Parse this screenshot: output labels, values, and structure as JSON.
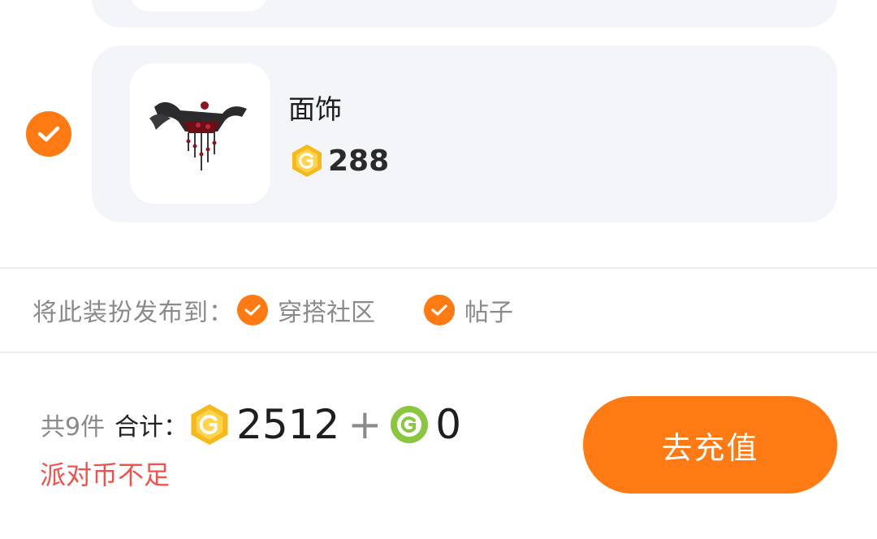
{
  "item": {
    "name": "面饰",
    "price": "288",
    "selected": true,
    "icon": "mask-accessory-image"
  },
  "publish": {
    "label": "将此装扮发布到：",
    "options": [
      {
        "label": "穿搭社区",
        "checked": true
      },
      {
        "label": "帖子",
        "checked": true
      }
    ]
  },
  "summary": {
    "count_text": "共9件",
    "total_label": "合计：",
    "gold_amount": "2512",
    "plus": "+",
    "green_amount": "0",
    "warning": "派对币不足"
  },
  "actions": {
    "recharge_label": "去充值"
  },
  "colors": {
    "accent": "#ff7a12",
    "warning": "#f0524c",
    "gold_coin": "#f6b91c",
    "green_coin": "#8bc63f",
    "card_bg": "#f4f5f9"
  }
}
